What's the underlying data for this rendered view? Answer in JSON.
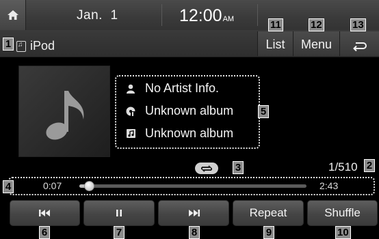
{
  "status_bar": {
    "date": "Jan.  1",
    "time": "12:00",
    "ampm": "AM"
  },
  "source": {
    "label": "iPod"
  },
  "header_buttons": {
    "list": "List",
    "menu": "Menu"
  },
  "track": {
    "artist": "No Artist Info.",
    "album": "Unknown album",
    "song": "Unknown album"
  },
  "counter": "1/510",
  "progress": {
    "elapsed": "0:07",
    "total": "2:43",
    "fraction": 0.043
  },
  "controls": {
    "repeat": "Repeat",
    "shuffle": "Shuffle"
  },
  "callouts": {
    "c1": "1",
    "c2": "2",
    "c3": "3",
    "c4": "4",
    "c5": "5",
    "c6": "6",
    "c7": "7",
    "c8": "8",
    "c9": "9",
    "c10": "10",
    "c11": "11",
    "c12": "12",
    "c13": "13"
  },
  "icons": {
    "home": "home-icon",
    "source": "ipod-icon",
    "back": "back-icon",
    "art": "music-note-icon",
    "artist": "person-icon",
    "album": "disc-icon",
    "song": "song-icon",
    "repeat": "repeat-icon",
    "prev": "previous-track-icon",
    "pause": "pause-icon",
    "next": "next-track-icon"
  }
}
